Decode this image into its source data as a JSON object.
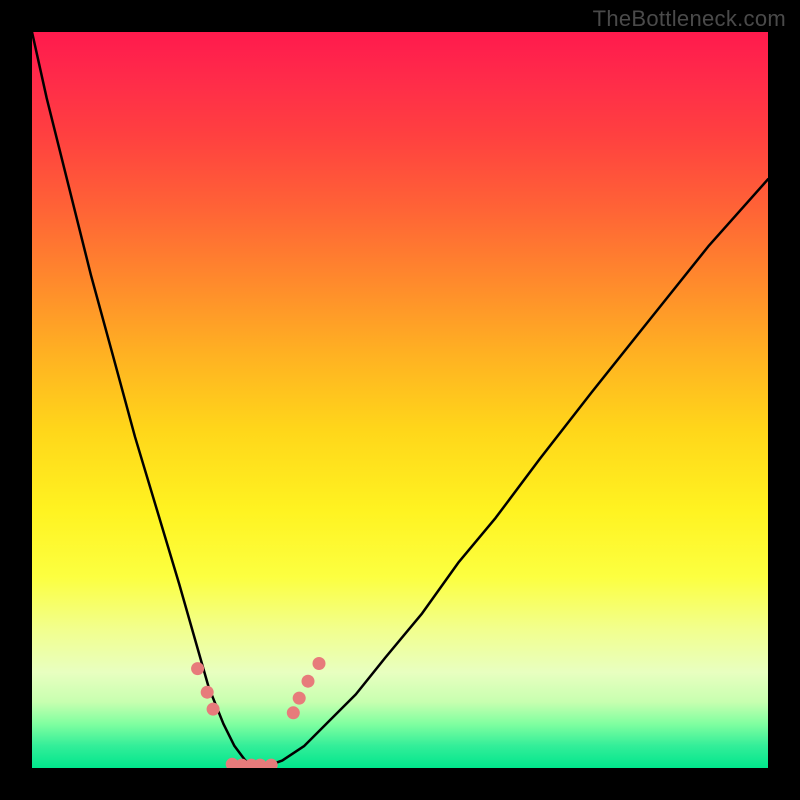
{
  "watermark": "TheBottleneck.com",
  "colors": {
    "page_bg": "#000000",
    "curve_stroke": "#000000",
    "marker_fill": "#e77b7b",
    "gradient_top": "#ff1a4d",
    "gradient_bottom": "#00e68c"
  },
  "chart_data": {
    "type": "line",
    "title": "",
    "xlabel": "",
    "ylabel": "",
    "xlim": [
      0,
      100
    ],
    "ylim": [
      0,
      100
    ],
    "grid": false,
    "legend": false,
    "note": "V-shaped bottleneck curve on red→green gradient background; x is resource index (0–100 across plot width), y is bottleneck magnitude (0 at bottom, 100 at top). Values estimated from pixel positions; no axis labels shown.",
    "series": [
      {
        "name": "bottleneck-curve",
        "x": [
          0,
          2,
          5,
          8,
          11,
          14,
          17,
          20,
          22,
          24,
          26,
          27.5,
          29,
          30.5,
          32,
          34,
          37,
          40,
          44,
          48,
          53,
          58,
          63,
          69,
          76,
          84,
          92,
          100
        ],
        "y": [
          100,
          91,
          79,
          67,
          56,
          45,
          35,
          25,
          18,
          11,
          6,
          3,
          1,
          0.3,
          0.3,
          1,
          3,
          6,
          10,
          15,
          21,
          28,
          34,
          42,
          51,
          61,
          71,
          80
        ]
      }
    ],
    "markers": [
      {
        "x": 22.5,
        "y": 13.5
      },
      {
        "x": 23.8,
        "y": 10.3
      },
      {
        "x": 24.6,
        "y": 8.0
      },
      {
        "x": 27.2,
        "y": 0.5
      },
      {
        "x": 28.5,
        "y": 0.4
      },
      {
        "x": 29.8,
        "y": 0.4
      },
      {
        "x": 31.0,
        "y": 0.4
      },
      {
        "x": 32.5,
        "y": 0.4
      },
      {
        "x": 35.5,
        "y": 7.5
      },
      {
        "x": 36.3,
        "y": 9.5
      },
      {
        "x": 37.5,
        "y": 11.8
      },
      {
        "x": 39.0,
        "y": 14.2
      }
    ]
  }
}
